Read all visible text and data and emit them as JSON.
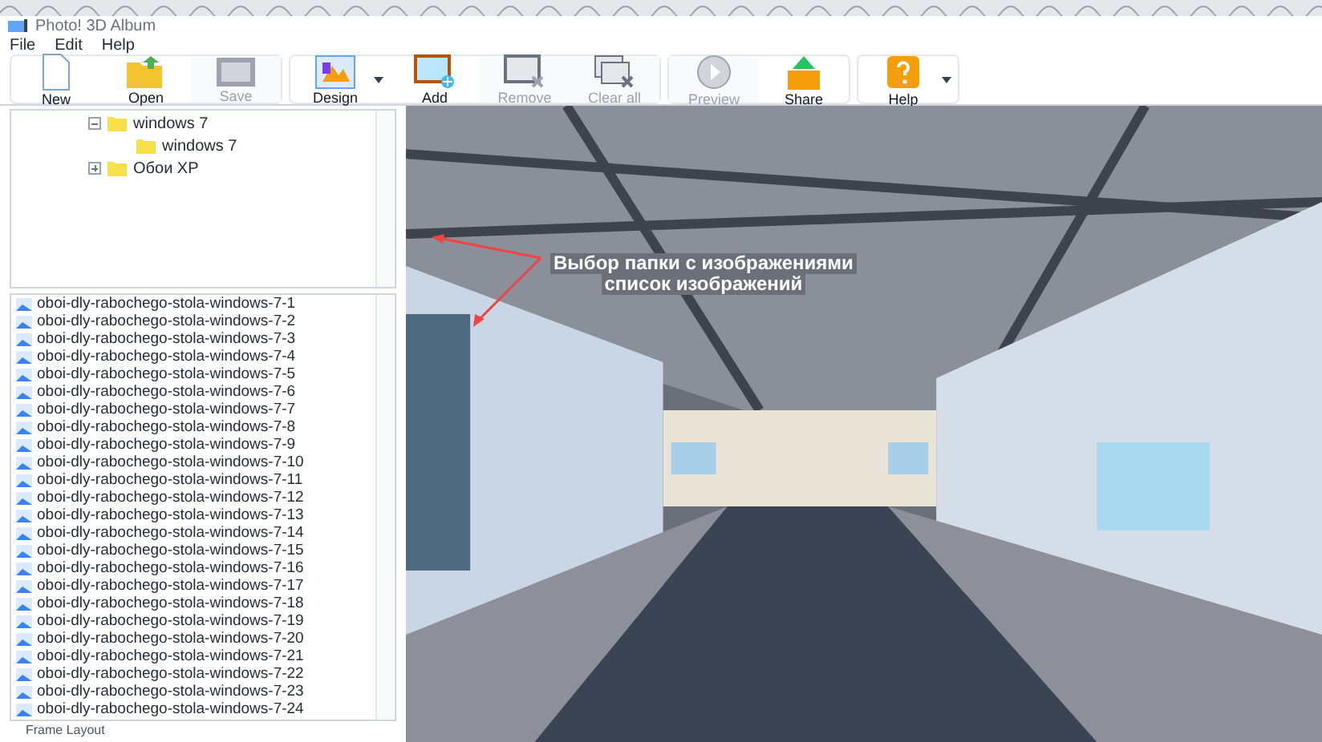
{
  "window": {
    "title": "Photo! 3D Album"
  },
  "menu": [
    "File",
    "Edit",
    "Help"
  ],
  "toolbar": {
    "groups": [
      [
        {
          "label": "New",
          "kind": "new",
          "disabled": false,
          "dropdown": false
        },
        {
          "label": "Open",
          "kind": "open",
          "disabled": false,
          "dropdown": false
        },
        {
          "label": "Save",
          "kind": "save",
          "disabled": true,
          "dropdown": false
        }
      ],
      [
        {
          "label": "Design",
          "kind": "design",
          "disabled": false,
          "dropdown": true
        },
        {
          "label": "Add",
          "kind": "add",
          "disabled": false,
          "dropdown": false
        },
        {
          "label": "Remove",
          "kind": "remove",
          "disabled": true,
          "dropdown": false
        },
        {
          "label": "Clear all",
          "kind": "clear",
          "disabled": true,
          "dropdown": false
        }
      ],
      [
        {
          "label": "Preview",
          "kind": "preview",
          "disabled": true,
          "dropdown": false
        },
        {
          "label": "Share",
          "kind": "share",
          "disabled": false,
          "dropdown": false
        }
      ],
      [
        {
          "label": "Help",
          "kind": "help",
          "disabled": false,
          "dropdown": true
        }
      ]
    ]
  },
  "folder_tree": [
    {
      "label": "windows 7",
      "expanded": true,
      "children": [
        {
          "label": "windows 7"
        }
      ]
    },
    {
      "label": "Обои XP",
      "expanded": false
    }
  ],
  "image_list": [
    "oboi-dly-rabochego-stola-windows-7-1",
    "oboi-dly-rabochego-stola-windows-7-2",
    "oboi-dly-rabochego-stola-windows-7-3",
    "oboi-dly-rabochego-stola-windows-7-4",
    "oboi-dly-rabochego-stola-windows-7-5",
    "oboi-dly-rabochego-stola-windows-7-6",
    "oboi-dly-rabochego-stola-windows-7-7",
    "oboi-dly-rabochego-stola-windows-7-8",
    "oboi-dly-rabochego-stola-windows-7-9",
    "oboi-dly-rabochego-stola-windows-7-10",
    "oboi-dly-rabochego-stola-windows-7-11",
    "oboi-dly-rabochego-stola-windows-7-12",
    "oboi-dly-rabochego-stola-windows-7-13",
    "oboi-dly-rabochego-stola-windows-7-14",
    "oboi-dly-rabochego-stola-windows-7-15",
    "oboi-dly-rabochego-stola-windows-7-16",
    "oboi-dly-rabochego-stola-windows-7-17",
    "oboi-dly-rabochego-stola-windows-7-18",
    "oboi-dly-rabochego-stola-windows-7-19",
    "oboi-dly-rabochego-stola-windows-7-20",
    "oboi-dly-rabochego-stola-windows-7-21",
    "oboi-dly-rabochego-stola-windows-7-22",
    "oboi-dly-rabochego-stola-windows-7-23",
    "oboi-dly-rabochego-stola-windows-7-24"
  ],
  "panel_label": "Frame Layout",
  "annotation": [
    "Выбор папки с изображениями",
    "список изображений"
  ]
}
